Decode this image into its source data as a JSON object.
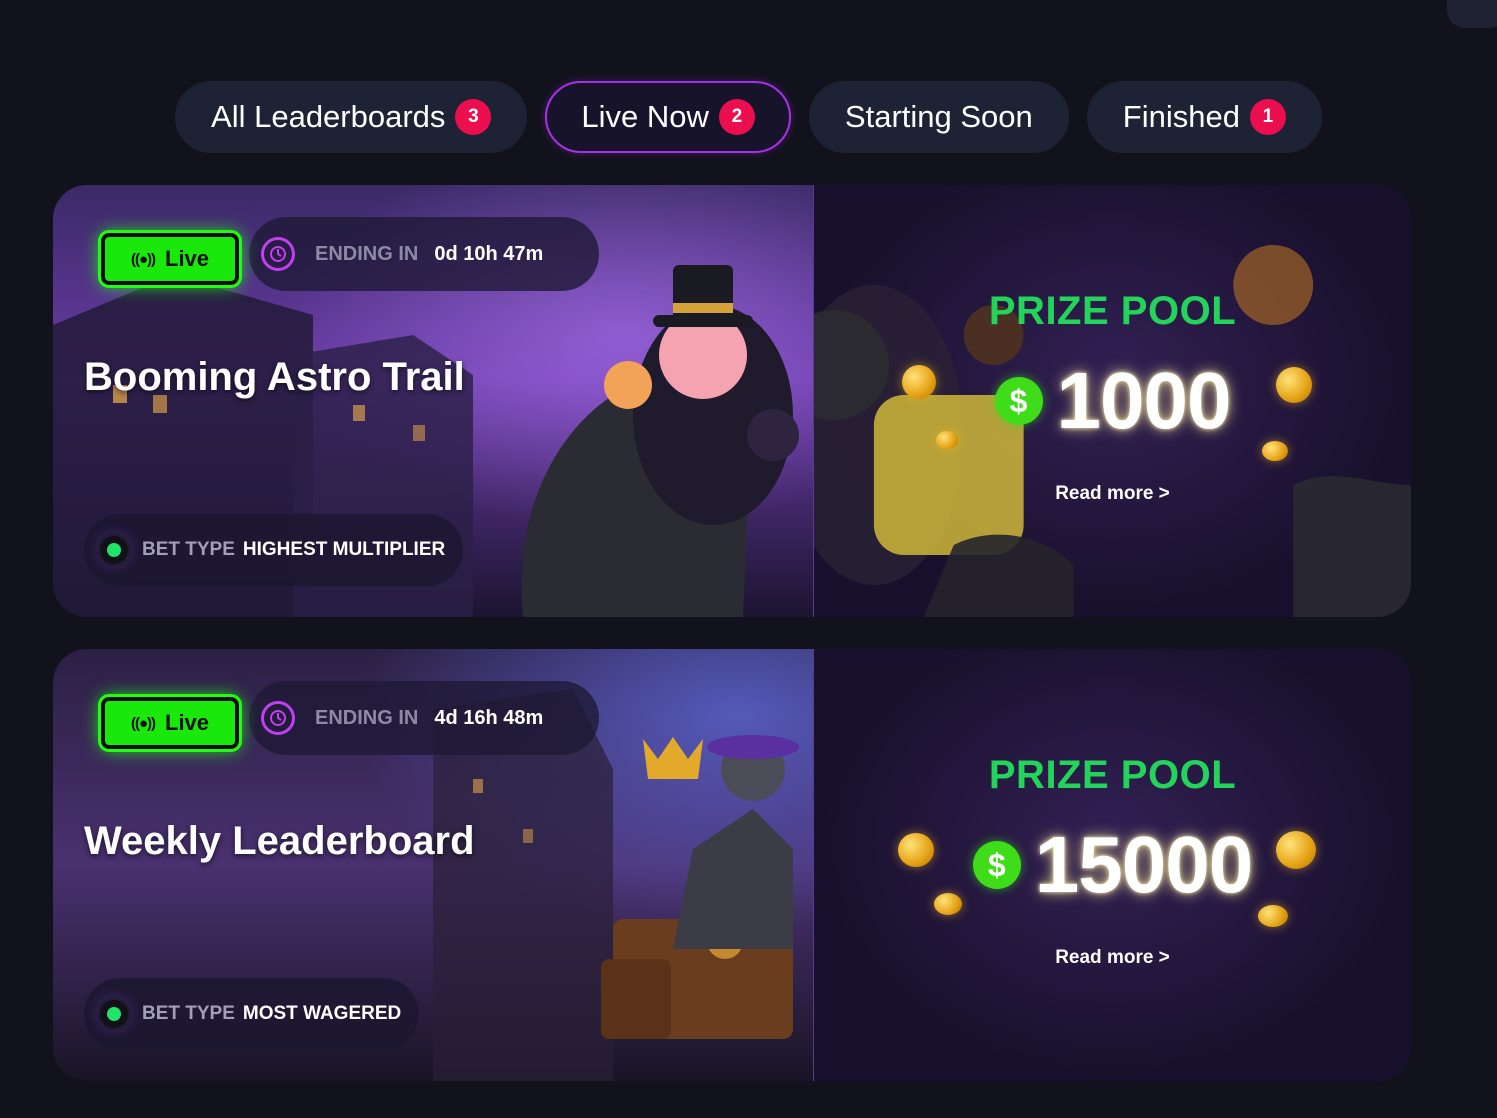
{
  "tabs": [
    {
      "label": "All Leaderboards",
      "count": "3"
    },
    {
      "label": "Live Now",
      "count": "2"
    },
    {
      "label": "Starting Soon",
      "count": ""
    },
    {
      "label": "Finished",
      "count": "1"
    }
  ],
  "active_tab": "Live Now",
  "colors": {
    "accent_purple": "#a531e6",
    "live_green": "#19e80a",
    "prize_green": "#23d45a",
    "badge_red": "#ec0f4f"
  },
  "leaderboards": [
    {
      "status": "Live",
      "ending_label": "ENDING IN",
      "ending_value": "0d 10h 47m",
      "title": "Booming Astro Trail",
      "bet_type_label": "BET TYPE",
      "bet_type_value": "HIGHEST MULTIPLIER",
      "prize_title": "PRIZE POOL",
      "prize_currency": "$",
      "prize_amount": "1000",
      "read_more": "Read more >"
    },
    {
      "status": "Live",
      "ending_label": "ENDING IN",
      "ending_value": "4d 16h 48m",
      "title": "Weekly Leaderboard",
      "bet_type_label": "BET TYPE",
      "bet_type_value": "MOST WAGERED",
      "prize_title": "PRIZE POOL",
      "prize_currency": "$",
      "prize_amount": "15000",
      "read_more": "Read more >"
    }
  ]
}
